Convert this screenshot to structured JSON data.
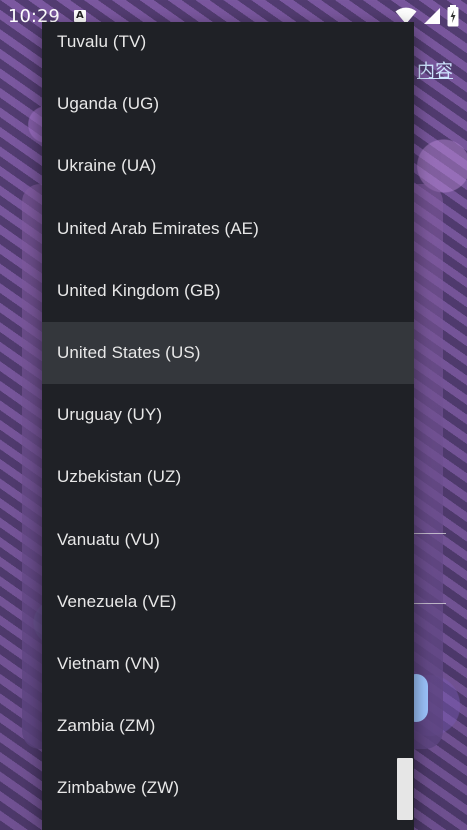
{
  "status_bar": {
    "time": "10:29",
    "notification_icon_label": "A",
    "icons": [
      "notification-icon",
      "wifi-icon",
      "signal-icon",
      "battery-icon"
    ]
  },
  "background": {
    "link_text": "内容"
  },
  "dropdown": {
    "options": [
      {
        "label": "Tuvalu (TV)"
      },
      {
        "label": "Uganda (UG)"
      },
      {
        "label": "Ukraine (UA)"
      },
      {
        "label": "United Arab Emirates (AE)"
      },
      {
        "label": "United Kingdom (GB)"
      },
      {
        "label": "United States (US)"
      },
      {
        "label": "Uruguay (UY)"
      },
      {
        "label": "Uzbekistan (UZ)"
      },
      {
        "label": "Vanuatu (VU)"
      },
      {
        "label": "Venezuela (VE)"
      },
      {
        "label": "Vietnam (VN)"
      },
      {
        "label": "Zambia (ZM)"
      },
      {
        "label": "Zimbabwe (ZW)"
      }
    ],
    "selected_value": "United States (US)"
  },
  "colors": {
    "menu_background": "#1f2126",
    "selected_background": "#34373c",
    "text": "#e8e8e8",
    "accent_button": "#9ec6ff"
  }
}
